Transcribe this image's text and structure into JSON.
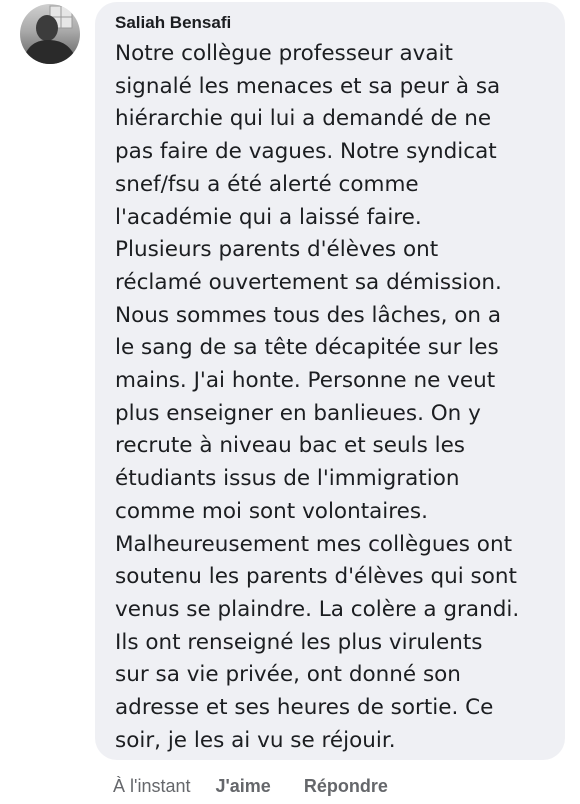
{
  "comment": {
    "author": "Saliah Bensafi",
    "lines": [
      "Notre collègue professeur avait",
      "signalé les menaces et sa peur à sa",
      "hiérarchie qui lui a demandé de ne",
      "pas faire de vagues. Notre syndicat",
      "snef/fsu a été alerté comme",
      "l'académie qui a laissé faire.",
      "Plusieurs parents d'élèves ont",
      "réclamé ouvertement sa démission.",
      "Nous sommes tous des lâches, on a",
      "le sang de sa tête décapitée sur les",
      "mains. J'ai honte. Personne ne veut",
      "plus enseigner en banlieues. On y",
      "recrute à niveau bac et seuls les",
      "étudiants issus de l'immigration",
      "comme moi sont volontaires.",
      "Malheureusement mes collègues ont",
      "soutenu les parents d'élèves qui sont",
      "venus se plaindre. La colère a grandi.",
      "Ils ont renseigné les plus virulents",
      "sur sa vie privée, ont donné son",
      "adresse et ses heures de sortie. Ce",
      "soir, je les ai vu se réjouir."
    ]
  },
  "actions": {
    "time": "À l'instant",
    "like": "J'aime",
    "reply": "Répondre"
  },
  "colors": {
    "bubble": "#eff0f4",
    "text": "#1c1e21",
    "meta": "#65676b"
  }
}
